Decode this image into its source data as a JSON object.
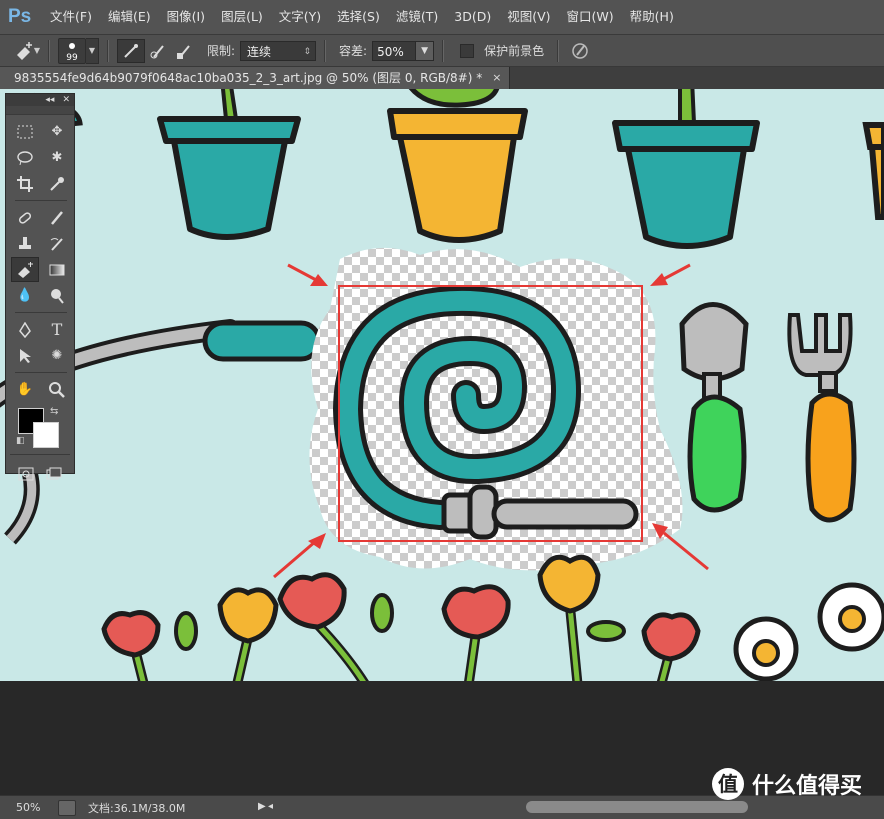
{
  "app": {
    "logo": "Ps"
  },
  "menu": [
    "文件(F)",
    "编辑(E)",
    "图像(I)",
    "图层(L)",
    "文字(Y)",
    "选择(S)",
    "滤镜(T)",
    "3D(D)",
    "视图(V)",
    "窗口(W)",
    "帮助(H)"
  ],
  "options": {
    "brush_size": "99",
    "limit_label": "限制:",
    "limit_value": "连续",
    "tolerance_label": "容差:",
    "tolerance_value": "50%",
    "protect_fg_label": "保护前景色"
  },
  "document": {
    "tab_title": "9835554fe9d64b9079f0648ac10ba035_2_3_art.jpg @ 50% (图层 0, RGB/8#) *",
    "close": "×"
  },
  "status": {
    "zoom": "50%",
    "doc_info": "文档:36.1M/38.0M"
  },
  "watermark": {
    "text": "什么值得买",
    "logo_char": "值"
  },
  "colors": {
    "canvas_bg": "#c9e8e7",
    "teal": "#2aa9a6",
    "yellow": "#f4b533",
    "red": "#e55a55",
    "green": "#7bbf3a",
    "gray": "#b8b8b8",
    "annotation_red": "#e53935"
  },
  "toolbox": {
    "tools": [
      "marquee",
      "move",
      "lasso",
      "magic-wand",
      "crop",
      "eyedropper",
      "spot-heal",
      "brush",
      "clone-stamp",
      "history-brush",
      "background-eraser",
      "gradient",
      "blur",
      "dodge",
      "pen",
      "type",
      "path-select",
      "custom-shape",
      "hand",
      "zoom"
    ]
  }
}
